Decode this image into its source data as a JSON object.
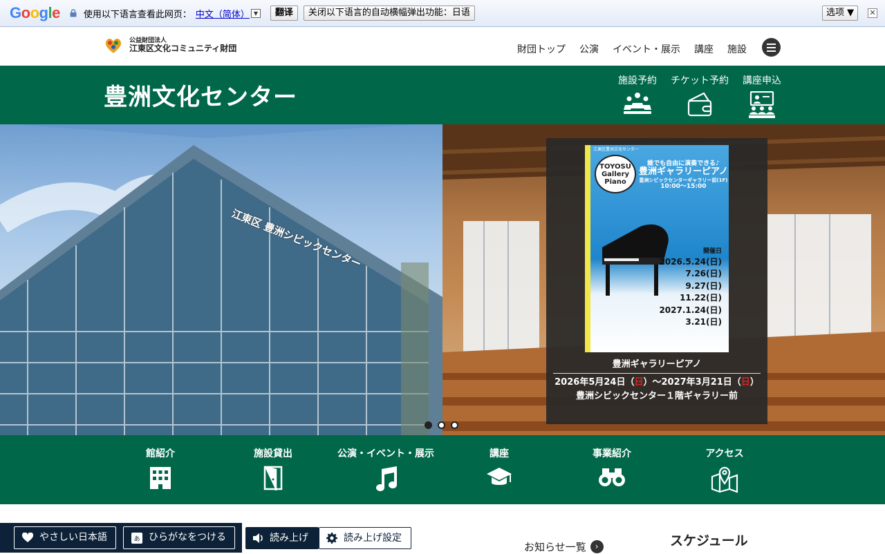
{
  "translate_bar": {
    "logo_letters": [
      "G",
      "o",
      "o",
      "g",
      "l",
      "e"
    ],
    "prompt": "使用以下语言查看此网页：",
    "language": "中文（简体）",
    "dropdown_glyph": "▼",
    "translate_button": "翻译",
    "disable_button": "关闭以下语言的自动横幅弹出功能：日语",
    "options_button": "选项 ▼",
    "close_glyph": "✕"
  },
  "header": {
    "org_sub": "公益財団法人",
    "org_name": "江東区文化コミュニティ財団",
    "nav": [
      "財団トップ",
      "公演",
      "イベント・展示",
      "講座",
      "施設"
    ]
  },
  "title_band": {
    "title": "豊洲文化センター",
    "quick_links": [
      {
        "label": "施設予約",
        "icon": "people-meeting-icon"
      },
      {
        "label": "チケット予約",
        "icon": "ticket-icon"
      },
      {
        "label": "講座申込",
        "icon": "lecture-icon"
      }
    ]
  },
  "hero": {
    "building_sign": "江東区 豊洲シビックセンター",
    "poster": {
      "header": "江東区豊洲文化センター",
      "tagline": "誰でも自由に演奏できる♪",
      "title": "豊洲ギャラリーピアノ",
      "subtitle": "豊洲シビックセンターギャラリー前(1F)",
      "hours": "10:00〜15:00",
      "badge": [
        "TOYOSU",
        "Gallery",
        "Piano"
      ],
      "dates_label": "開催日",
      "dates": [
        "2026.5.24(日)",
        "7.26(日)",
        "9.27(日)",
        "11.22(日)",
        "2027.1.24(日)",
        "3.21(日)"
      ]
    },
    "event_name": "豊洲ギャラリーピアノ",
    "event_date_start": "2026年5月24日（",
    "event_date_hol1": "日",
    "event_date_mid": "）～2027年3月21日（",
    "event_date_hol2": "日",
    "event_date_end": "）",
    "event_place": "豊洲シビックセンター１階ギャラリー前",
    "slides": 3,
    "active_slide": 1
  },
  "nav_band": {
    "items": [
      {
        "label": "館紹介",
        "icon": "building-icon"
      },
      {
        "label": "施設貸出",
        "icon": "door-icon"
      },
      {
        "label": "公演・イベント・展示",
        "icon": "music-note-icon"
      },
      {
        "label": "講座",
        "icon": "graduation-cap-icon"
      },
      {
        "label": "事業紹介",
        "icon": "binoculars-icon"
      },
      {
        "label": "アクセス",
        "icon": "map-pin-icon"
      }
    ]
  },
  "bottom": {
    "easy_japanese": "やさしい日本語",
    "hiragana": "ひらがなをつける",
    "read_aloud": "読み上げ",
    "read_settings": "読み上げ設定",
    "news_list": "お知らせ一覧",
    "schedule": "スケジュール"
  }
}
